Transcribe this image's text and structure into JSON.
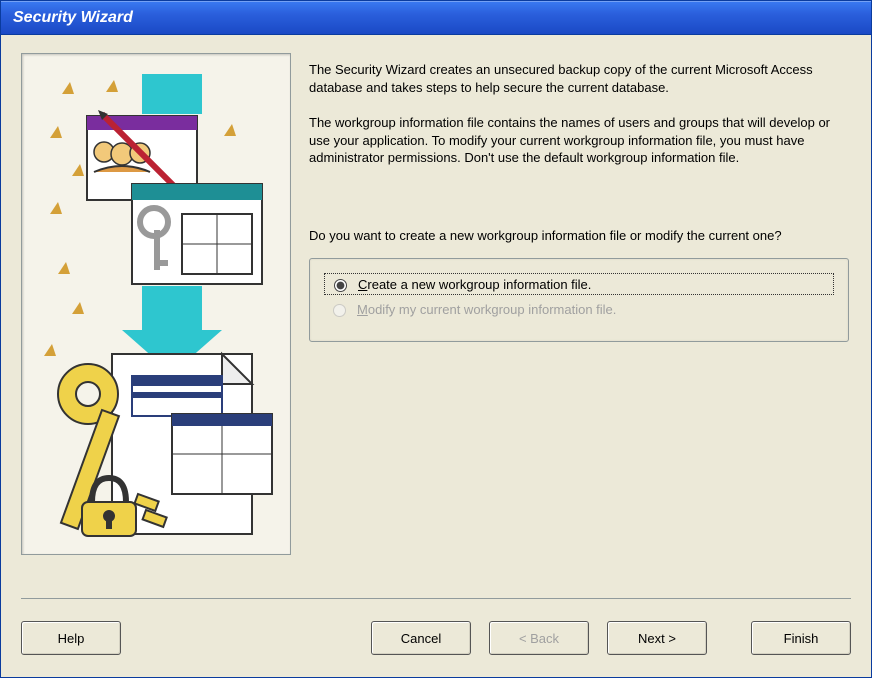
{
  "window": {
    "title": "Security Wizard"
  },
  "content": {
    "paragraph1": "The Security Wizard creates an unsecured backup copy of the current Microsoft Access database and takes steps to help secure the current database.",
    "paragraph2": "The workgroup information file contains the names of users and groups that will develop or use your application. To modify your current workgroup information file, you must have administrator permissions. Don't use the default workgroup information file.",
    "question": "Do you want to create a new workgroup information file or modify the current one?",
    "options": {
      "create": "Create a new workgroup information file.",
      "modify": "Modify my current workgroup information file."
    }
  },
  "buttons": {
    "help": "Help",
    "cancel": "Cancel",
    "back": "< Back",
    "next": "Next >",
    "finish": "Finish"
  }
}
